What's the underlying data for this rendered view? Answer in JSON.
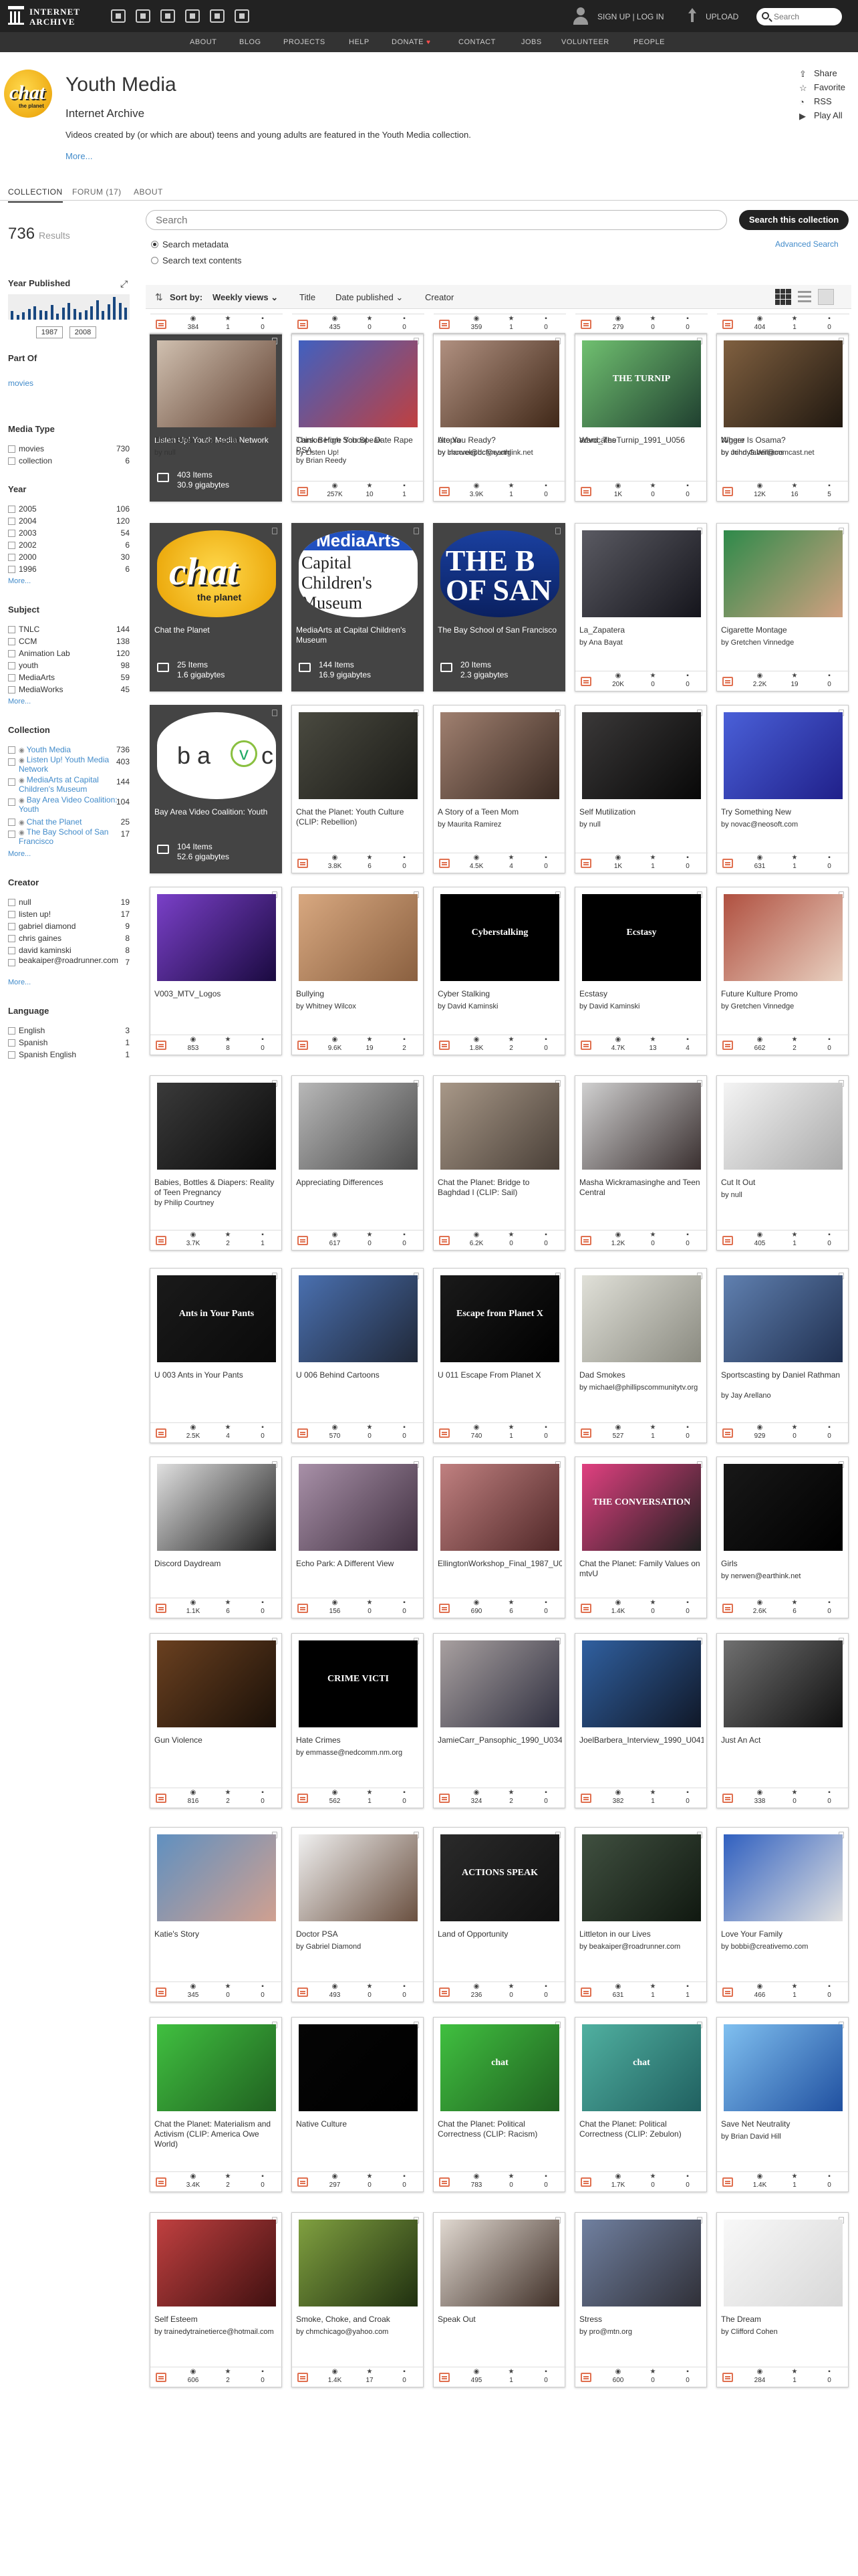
{
  "site": {
    "logo_line1": "INTERNET",
    "logo_line2": "ARCHIVE",
    "signup": "SIGN UP | LOG IN",
    "upload": "UPLOAD",
    "search_placeholder": "Search"
  },
  "nav": [
    "ABOUT",
    "BLOG",
    "PROJECTS",
    "HELP",
    "DONATE",
    "CONTACT",
    "JOBS",
    "VOLUNTEER",
    "PEOPLE"
  ],
  "collection": {
    "logo_text": "chat",
    "logo_sub": "the planet",
    "title": "Youth Media",
    "org": "Internet Archive",
    "description": "Videos created by (or which are about) teens and young adults are featured in the Youth Media collection.",
    "more": "More...",
    "actions": [
      "Share",
      "Favorite",
      "RSS",
      "Play All"
    ]
  },
  "tabs": [
    "COLLECTION",
    "FORUM (17)",
    "ABOUT"
  ],
  "results": {
    "count": "736",
    "label": "Results"
  },
  "year_published": {
    "heading": "Year Published",
    "from": "1987",
    "to": "2008",
    "bars": [
      0.35,
      0.2,
      0.3,
      0.45,
      0.55,
      0.4,
      0.35,
      0.6,
      0.25,
      0.5,
      0.7,
      0.45,
      0.3,
      0.4,
      0.55,
      0.8,
      0.35,
      0.65,
      0.95,
      0.7,
      0.5
    ]
  },
  "part_of": {
    "heading": "Part Of",
    "link": "movies"
  },
  "facets": [
    {
      "heading": "Media Type",
      "items": [
        {
          "label": "movies",
          "count": "730"
        },
        {
          "label": "collection",
          "count": "6"
        }
      ]
    },
    {
      "heading": "Year",
      "items": [
        {
          "label": "2005",
          "count": "106"
        },
        {
          "label": "2004",
          "count": "120"
        },
        {
          "label": "2003",
          "count": "54"
        },
        {
          "label": "2002",
          "count": "6"
        },
        {
          "label": "2000",
          "count": "30"
        },
        {
          "label": "1996",
          "count": "6"
        }
      ],
      "more": "More..."
    },
    {
      "heading": "Subject",
      "items": [
        {
          "label": "TNLC",
          "count": "144"
        },
        {
          "label": "CCM",
          "count": "138"
        },
        {
          "label": "Animation Lab",
          "count": "120"
        },
        {
          "label": "youth",
          "count": "98"
        },
        {
          "label": "MediaArts",
          "count": "59"
        },
        {
          "label": "MediaWorks",
          "count": "45"
        }
      ],
      "more": "More..."
    },
    {
      "heading": "Collection",
      "items": [
        {
          "label": "Youth Media",
          "count": "736",
          "link": true
        },
        {
          "label": "Listen Up! Youth Media Network",
          "count": "403",
          "link": true,
          "two": true
        },
        {
          "label": "MediaArts at Capital Children's Museum",
          "count": "144",
          "link": true,
          "two": true
        },
        {
          "label": "Bay Area Video Coalition: Youth",
          "count": "104",
          "link": true,
          "two": true
        },
        {
          "label": "Chat the Planet",
          "count": "25",
          "link": true
        },
        {
          "label": "The Bay School of San Francisco",
          "count": "17",
          "link": true,
          "two": true
        }
      ],
      "more": "More..."
    },
    {
      "heading": "Creator",
      "items": [
        {
          "label": "null",
          "count": "19"
        },
        {
          "label": "listen up!",
          "count": "17"
        },
        {
          "label": "gabriel diamond",
          "count": "9"
        },
        {
          "label": "chris gaines",
          "count": "8"
        },
        {
          "label": "david kaminski",
          "count": "8"
        },
        {
          "label": "beakaiper@roadrunner.com",
          "count": "7",
          "two": true
        }
      ],
      "more": "More..."
    },
    {
      "heading": "Language",
      "items": [
        {
          "label": "English",
          "count": "3"
        },
        {
          "label": "Spanish",
          "count": "1"
        },
        {
          "label": "Spanish English",
          "count": "1"
        }
      ]
    }
  ],
  "search": {
    "placeholder": "Search",
    "button": "Search this collection",
    "opt_metadata": "Search metadata",
    "opt_text": "Search text contents",
    "advanced": "Advanced Search"
  },
  "sort": {
    "label": "Sort by:",
    "options": [
      "Weekly views",
      "Title",
      "Date published",
      "Creator"
    ]
  },
  "items": [
    {
      "t": "Listen Up! Youth Media Network",
      "coll": true,
      "n": "403 Items",
      "s": "30.9 gigabytes",
      "th": "listenup"
    },
    {
      "t": "Carson High School - Date Rape PSA",
      "by": "by Brian Reedy",
      "v": "257K",
      "f": "10",
      "r": "1",
      "c1": "#c9b0a8",
      "c2": "#6b4a48"
    },
    {
      "t": "Are You Ready?",
      "by": "by clanvel@dcfvny.org",
      "v": "3.9K",
      "f": "1",
      "r": "0",
      "c1": "#d7c07a",
      "c2": "#8a6b3a"
    },
    {
      "t": "advocates",
      "v": "1K",
      "f": "0",
      "r": "0",
      "c1": "#f0f0f0",
      "c2": "#9a9a9a"
    },
    {
      "t": "Nigger",
      "by": "by John G.Williams",
      "v": "12K",
      "f": "16",
      "r": "5",
      "c1": "#d8d0c8",
      "c2": "#3b2b23"
    },
    {
      "t": "Chat the Planet",
      "coll": true,
      "n": "25 Items",
      "s": "1.6 gigabytes",
      "th": "chat"
    },
    {
      "t": "MediaArts at Capital Children's Museum",
      "coll": true,
      "n": "144 Items",
      "s": "16.9 gigabytes",
      "th": "mediaarts"
    },
    {
      "t": "The Bay School of San Francisco",
      "coll": true,
      "n": "20 Items",
      "s": "2.3 gigabytes",
      "th": "bay"
    },
    {
      "t": "La_Zapatera",
      "by": "by Ana Bayat",
      "v": "20K",
      "f": "0",
      "r": "0",
      "c1": "#5a5a62",
      "c2": "#15151c"
    },
    {
      "t": "Cigarette Montage",
      "by": "by Gretchen Vinnedge",
      "v": "2.2K",
      "f": "19",
      "r": "0",
      "c1": "#2e8a4a",
      "c2": "#d0a080"
    },
    {
      "t": "Bay Area Video Coalition: Youth",
      "coll": true,
      "n": "104 Items",
      "s": "52.6 gigabytes",
      "th": "bavc"
    },
    {
      "t": "Chat the Planet: Youth Culture (CLIP: Rebellion)",
      "v": "3.8K",
      "f": "6",
      "r": "0",
      "c1": "#4a4a40",
      "c2": "#1a1a16"
    },
    {
      "t": "A Story of a Teen Mom",
      "by": "by Maurita Ramirez",
      "v": "4.5K",
      "f": "4",
      "r": "0",
      "c1": "#a08070",
      "c2": "#3a2a22"
    },
    {
      "t": "Self Mutilization",
      "by": "by null",
      "v": "1K",
      "f": "1",
      "r": "0",
      "c1": "#3a3838",
      "c2": "#080808"
    },
    {
      "t": "Try Something New",
      "by": "by novac@neosoft.com",
      "v": "631",
      "f": "1",
      "r": "0",
      "c1": "#4a60d8",
      "c2": "#20208a"
    },
    {
      "t": "V003_MTV_Logos",
      "v": "853",
      "f": "8",
      "r": "0",
      "c1": "#7a40c8",
      "c2": "#1a0a40"
    },
    {
      "t": "Bullying",
      "by": "by Whitney Wilcox",
      "v": "9.6K",
      "f": "19",
      "r": "2",
      "c1": "#d8a880",
      "c2": "#8a6040"
    },
    {
      "t": "Cyber Stalking",
      "by": "by David Kaminski",
      "v": "1.8K",
      "f": "2",
      "r": "0",
      "c1": "#000000",
      "c2": "#000000",
      "txt": "Cyberstalking"
    },
    {
      "t": "Ecstasy",
      "by": "by David Kaminski",
      "v": "4.7K",
      "f": "13",
      "r": "4",
      "c1": "#000000",
      "c2": "#000000",
      "txt": "Ecstasy"
    },
    {
      "t": "Future Kulture Promo",
      "by": "by Gretchen Vinnedge",
      "v": "662",
      "f": "2",
      "r": "0",
      "c1": "#b05040",
      "c2": "#e8d0c0"
    },
    {
      "t": "Babies, Bottles & Diapers: Reality of Teen Pregnancy",
      "by": "by Philip Courtney",
      "v": "3.7K",
      "f": "2",
      "r": "1",
      "c1": "#3a3a3a",
      "c2": "#0a0a0a"
    },
    {
      "t": "Appreciating Differences",
      "v": "617",
      "f": "0",
      "r": "0",
      "c1": "#b8b8b8",
      "c2": "#4a4a4a"
    },
    {
      "t": "Chat the Planet: Bridge to Baghdad I (CLIP: Sail)",
      "v": "6.2K",
      "f": "0",
      "r": "0",
      "c1": "#a89888",
      "c2": "#4a4038"
    },
    {
      "t": "Masha Wickramasinghe and Teen Central",
      "v": "1.2K",
      "f": "0",
      "r": "0",
      "c1": "#d0d0d0",
      "c2": "#3a3030"
    },
    {
      "t": "Cut It Out",
      "by": "by null",
      "v": "405",
      "f": "1",
      "r": "0",
      "c1": "#f4f4f4",
      "c2": "#aaaaaa"
    },
    {
      "t": "U 003 Ants in Your Pants",
      "v": "2.5K",
      "f": "4",
      "r": "0",
      "c1": "#1a1a1a",
      "c2": "#0a0a0a",
      "txt": "Ants in Your Pants"
    },
    {
      "t": "U 006 Behind Cartoons",
      "v": "570",
      "f": "0",
      "r": "0",
      "c1": "#4a70b0",
      "c2": "#202838"
    },
    {
      "t": "U 011 Escape From Planet X",
      "v": "740",
      "f": "1",
      "r": "0",
      "c1": "#1a1a1a",
      "c2": "#000000",
      "txt": "Escape from Planet X"
    },
    {
      "t": "Dad Smokes",
      "by": "by michael@phillipscommunitytv.org",
      "v": "527",
      "f": "1",
      "r": "0",
      "c1": "#e0e0d8",
      "c2": "#8a8a80"
    },
    {
      "t": "Sportscasting by Daniel Rathman",
      "by": "by Jay Arellano",
      "v": "929",
      "f": "0",
      "r": "0",
      "c1": "#6080b0",
      "c2": "#203050"
    },
    {
      "t": "Discord Daydream",
      "v": "1.1K",
      "f": "6",
      "r": "0",
      "c1": "#e0e0e0",
      "c2": "#202020"
    },
    {
      "t": "Echo Park: A Different View",
      "v": "156",
      "f": "0",
      "r": "0",
      "c1": "#a890a8",
      "c2": "#403040"
    },
    {
      "t": "EllingtonWorkshop_Final_1987_U002",
      "v": "690",
      "f": "6",
      "r": "0",
      "c1": "#c08080",
      "c2": "#502828"
    },
    {
      "t": "Chat the Planet: Family Values on mtvU",
      "v": "1.4K",
      "f": "0",
      "r": "0",
      "c1": "#e04080",
      "c2": "#202020",
      "txt": "THE CONVERSATION"
    },
    {
      "t": "Girls",
      "by": "by nerwen@earthink.net",
      "v": "2.6K",
      "f": "6",
      "r": "0",
      "c1": "#181818",
      "c2": "#000000"
    },
    {
      "t": "Gun Violence",
      "v": "816",
      "f": "2",
      "r": "0",
      "c1": "#6a4020",
      "c2": "#1a1008"
    },
    {
      "t": "Hate Crimes",
      "by": "by emmasse@nedcomm.nm.org",
      "v": "562",
      "f": "1",
      "r": "0",
      "c1": "#000000",
      "c2": "#000000",
      "txt": "CRIME VICTI"
    },
    {
      "t": "JamieCarr_Pansophic_1990_U034",
      "v": "324",
      "f": "2",
      "r": "0",
      "c1": "#a8a0a0",
      "c2": "#303040"
    },
    {
      "t": "JoelBarbera_Interview_1990_U041",
      "v": "382",
      "f": "1",
      "r": "0",
      "c1": "#3060a0",
      "c2": "#101828"
    },
    {
      "t": "Just An Act",
      "v": "338",
      "f": "0",
      "r": "0",
      "c1": "#707070",
      "c2": "#101010"
    },
    {
      "t": "Katie's Story",
      "v": "345",
      "f": "0",
      "r": "0",
      "c1": "#6090c0",
      "c2": "#d0a090"
    },
    {
      "t": "Doctor PSA",
      "by": "by Gabriel Diamond",
      "v": "493",
      "f": "0",
      "r": "0",
      "c1": "#f0f0f0",
      "c2": "#6a5040"
    },
    {
      "t": "Land of Opportunity",
      "v": "236",
      "f": "0",
      "r": "0",
      "c1": "#2a2a2a",
      "c2": "#101010",
      "txt": "ACTIONS SPEAK"
    },
    {
      "t": "Littleton in our Lives",
      "by": "by beakaiper@roadrunner.com",
      "v": "631",
      "f": "1",
      "r": "1",
      "c1": "#405040",
      "c2": "#101810"
    },
    {
      "t": "Love Your Family",
      "by": "by bobbi@creativemo.com",
      "v": "466",
      "f": "1",
      "r": "0",
      "c1": "#3060c0",
      "c2": "#e0e0e0"
    },
    {
      "t": "Chat the Planet: Materialism and Activism (CLIP: America Owe World)",
      "v": "3.4K",
      "f": "2",
      "r": "0",
      "c1": "#40c040",
      "c2": "#206020"
    },
    {
      "t": "Native Culture",
      "v": "297",
      "f": "0",
      "r": "0",
      "c1": "#050505",
      "c2": "#000000"
    },
    {
      "t": "Chat the Planet: Political Correctness (CLIP: Racism)",
      "v": "783",
      "f": "0",
      "r": "0",
      "c1": "#40c040",
      "c2": "#206020",
      "txt": "chat"
    },
    {
      "t": "Chat the Planet: Political Correctness (CLIP: Zebulon)",
      "v": "1.7K",
      "f": "0",
      "r": "0",
      "c1": "#50b0a0",
      "c2": "#206060",
      "txt": "chat"
    },
    {
      "t": "Save Net Neutrality",
      "by": "by Brian David Hill",
      "v": "1.4K",
      "f": "1",
      "r": "0",
      "c1": "#80c0f0",
      "c2": "#2050a0"
    },
    {
      "t": "Self Esteem",
      "by": "by trainedytrainetierce@hotmail.com",
      "v": "606",
      "f": "2",
      "r": "0",
      "c1": "#c04040",
      "c2": "#401010"
    },
    {
      "t": "Smoke, Choke, and Croak",
      "by": "by chmchicago@yahoo.com",
      "v": "1.4K",
      "f": "17",
      "r": "0",
      "c1": "#80a040",
      "c2": "#203010"
    },
    {
      "t": "Speak Out",
      "v": "495",
      "f": "1",
      "r": "0",
      "c1": "#e0d8d0",
      "c2": "#403028"
    },
    {
      "t": "Stress",
      "by": "by pro@mtn.org",
      "v": "600",
      "f": "0",
      "r": "0",
      "c1": "#7080a0",
      "c2": "#303038"
    },
    {
      "t": "The Dream",
      "by": "by Clifford Cohen",
      "v": "284",
      "f": "1",
      "r": "0",
      "c1": "#f8f8f8",
      "c2": "#d8d8d8"
    },
    {
      "t": "Think Before You Speak",
      "by": "by null",
      "v": "384",
      "f": "1",
      "r": "0",
      "c1": "#d0c0b0",
      "c2": "#604030"
    },
    {
      "t": "Think Before You Speak",
      "by": "by Listen Up!",
      "v": "435",
      "f": "0",
      "r": "0",
      "c1": "#4060c0",
      "c2": "#c04040"
    },
    {
      "t": "Utopia",
      "by": "by lmcoreepbc@earthlink.net",
      "v": "359",
      "f": "1",
      "r": "0",
      "c1": "#b09080",
      "c2": "#402818"
    },
    {
      "t": "Ward_TheTurnip_1991_U056",
      "v": "279",
      "f": "0",
      "r": "0",
      "c1": "#70c070",
      "c2": "#204030",
      "txt": "THE TURNIP"
    },
    {
      "t": "Where Is Osama?",
      "by": "by mindyfaber@comcast.net",
      "v": "404",
      "f": "1",
      "r": "0",
      "c1": "#806040",
      "c2": "#201810"
    }
  ]
}
